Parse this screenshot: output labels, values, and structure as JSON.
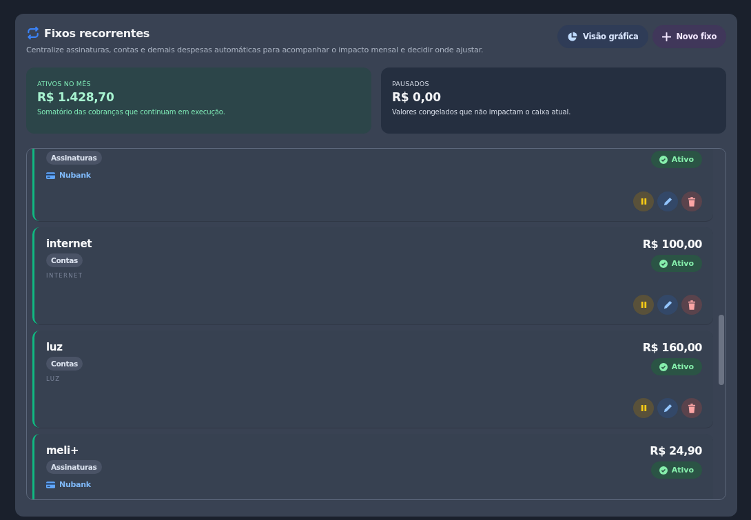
{
  "header": {
    "title": "Fixos recorrentes",
    "subtitle": "Centralize assinaturas, contas e demais despesas automáticas para acompanhar o impacto mensal e decidir onde ajustar."
  },
  "buttons": [
    {
      "label": "Visão gráfica",
      "kind": "chart"
    },
    {
      "label": "Novo fixo",
      "kind": "add"
    }
  ],
  "summary": [
    {
      "kind": "active",
      "label": "ATIVOS NO MÊS",
      "value": "R$ 1.428,70",
      "note": "Somatório das cobranças que continuam em execução."
    },
    {
      "kind": "paused",
      "label": "PAUSADOS",
      "value": "R$ 0,00",
      "note": "Valores congelados que não impactam o caixa atual."
    }
  ],
  "items": [
    {
      "tag": "Assinaturas",
      "account": "Nubank",
      "status": "Ativo",
      "active": true,
      "actions": [
        {
          "kind": "pause"
        },
        {
          "kind": "edit"
        },
        {
          "kind": "delete"
        }
      ]
    },
    {
      "name": "internet",
      "amount": "R$ 100,00",
      "tag": "Contas",
      "caption": "INTERNET",
      "status": "Ativo",
      "active": true,
      "actions": [
        {
          "kind": "pause"
        },
        {
          "kind": "edit"
        },
        {
          "kind": "delete"
        }
      ]
    },
    {
      "name": "luz",
      "amount": "R$ 160,00",
      "tag": "Contas",
      "caption": "LUZ",
      "status": "Ativo",
      "active": true,
      "actions": [
        {
          "kind": "pause"
        },
        {
          "kind": "edit"
        },
        {
          "kind": "delete"
        }
      ]
    },
    {
      "name": "meli+",
      "amount": "R$ 24,90",
      "tag": "Assinaturas",
      "account": "Nubank",
      "status": "Ativo",
      "active": true
    }
  ]
}
